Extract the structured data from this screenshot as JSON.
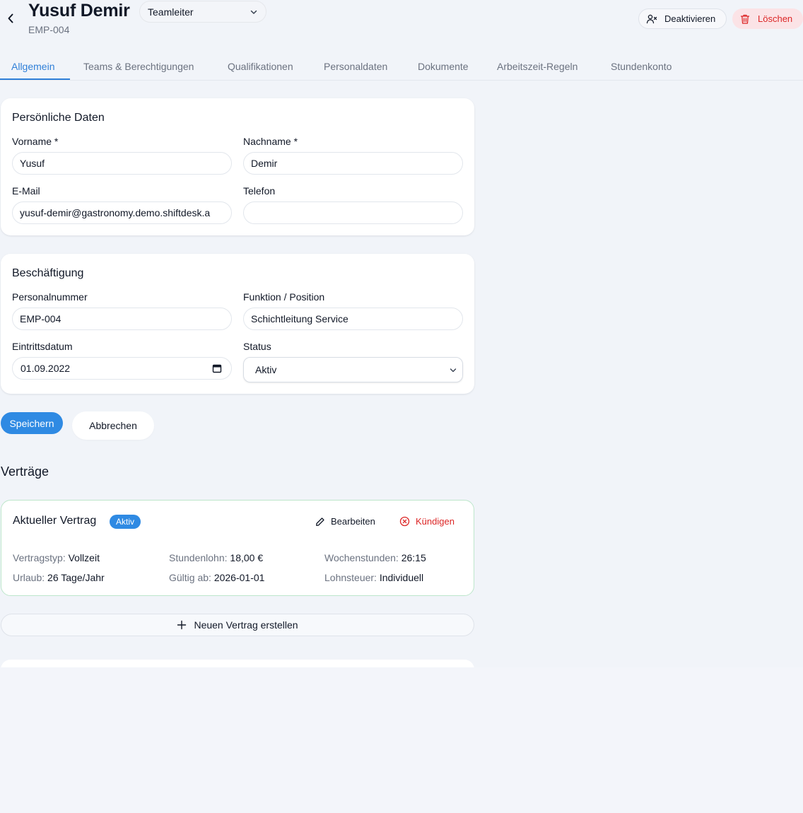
{
  "header": {
    "name": "Yusuf Demir",
    "employee_id": "EMP-004",
    "role": "Teamleiter",
    "deactivate_label": "Deaktivieren",
    "delete_label": "Löschen"
  },
  "tabs": [
    {
      "label": "Allgemein",
      "active": true
    },
    {
      "label": "Teams & Berechtigungen"
    },
    {
      "label": "Qualifikationen"
    },
    {
      "label": "Personaldaten"
    },
    {
      "label": "Dokumente"
    },
    {
      "label": "Arbeitszeit-Regeln"
    },
    {
      "label": "Stundenkonto"
    }
  ],
  "personal": {
    "title": "Persönliche Daten",
    "first_name_label": "Vorname *",
    "first_name": "Yusuf",
    "last_name_label": "Nachname *",
    "last_name": "Demir",
    "email_label": "E-Mail",
    "email": "yusuf-demir@gastronomy.demo.shiftdesk.a",
    "phone_label": "Telefon",
    "phone": ""
  },
  "employment": {
    "title": "Beschäftigung",
    "staff_number_label": "Personalnummer",
    "staff_number": "EMP-004",
    "position_label": "Funktion / Position",
    "position": "Schichtleitung Service",
    "entry_date_label": "Eintrittsdatum",
    "entry_date": "01.09.2022",
    "status_label": "Status",
    "status": "Aktiv"
  },
  "actions": {
    "save_label": "Speichern",
    "cancel_label": "Abbrechen"
  },
  "contracts": {
    "section_title": "Verträge",
    "current": {
      "title": "Aktueller Vertrag",
      "badge": "Aktiv",
      "edit_label": "Bearbeiten",
      "terminate_label": "Kündigen",
      "contract_type_key": "Vertragstyp:",
      "contract_type": "Vollzeit",
      "hourly_wage_key": "Stundenlohn:",
      "hourly_wage": "18,00 €",
      "weekly_hours_key": "Wochenstunden:",
      "weekly_hours": "26:15",
      "vacation_key": "Urlaub:",
      "vacation": "26 Tage/Jahr",
      "valid_from_key": "Gültig ab:",
      "valid_from": "2026-01-01",
      "tax_key": "Lohnsteuer:",
      "tax": "Individuell"
    },
    "new_contract_label": "Neuen Vertrag erstellen"
  },
  "colors": {
    "accent": "#2f8ae3",
    "danger": "#dc2626",
    "active_border": "#bde6cb"
  }
}
